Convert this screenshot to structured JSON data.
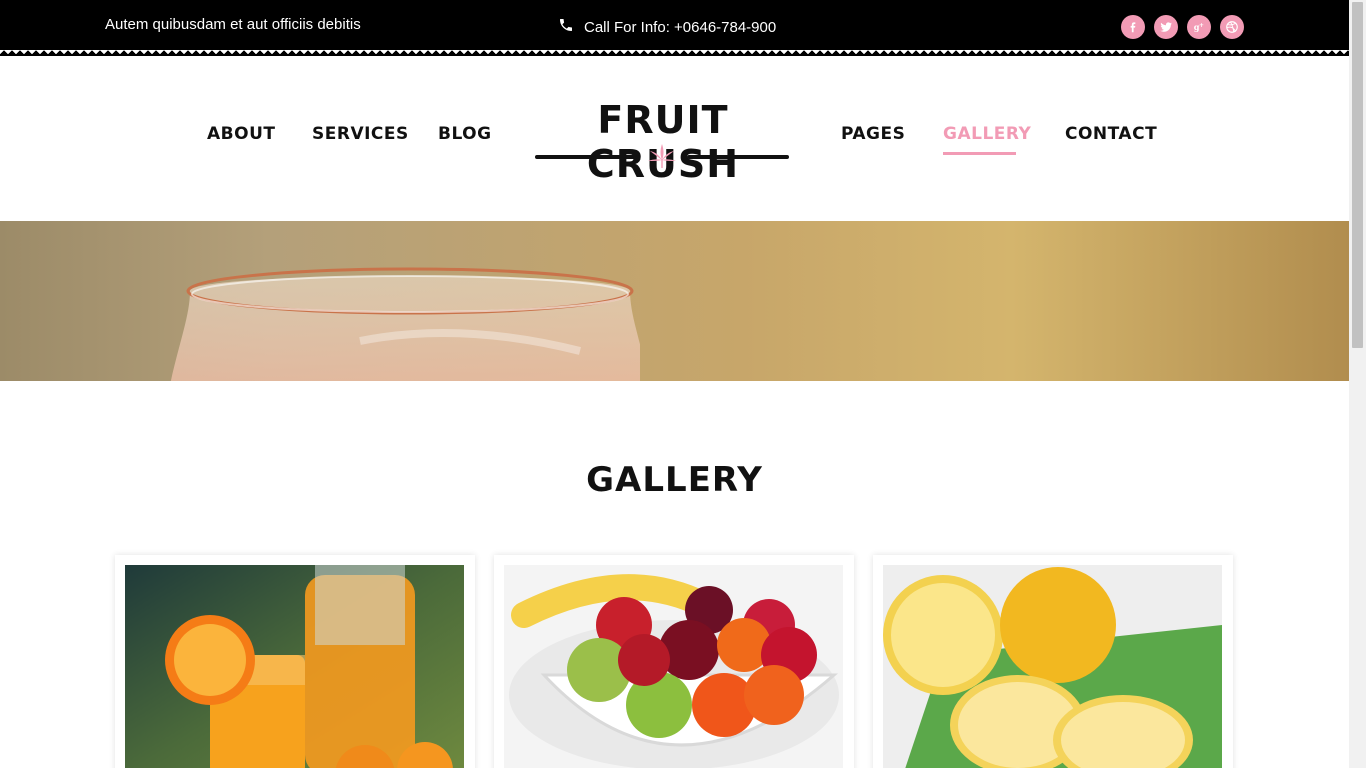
{
  "topbar": {
    "tagline": "Autem quibusdam et aut officiis debitis",
    "call_text": "Call For Info: +0646-784-900",
    "socials": [
      "facebook-icon",
      "twitter-icon",
      "google-plus-icon",
      "dribbble-icon"
    ]
  },
  "brand": {
    "logo": "FRUIT CRUSH",
    "accent": "#f29bb5"
  },
  "nav": {
    "about": "ABOUT",
    "services": "SERVICES",
    "blog": "BLOG",
    "pages": "PAGES",
    "gallery": "GALLERY",
    "contact": "CONTACT",
    "active": "GALLERY"
  },
  "gallery": {
    "title": "GALLERY",
    "items": [
      "orange-juice-image",
      "fruit-bowl-image",
      "lemons-image"
    ]
  }
}
